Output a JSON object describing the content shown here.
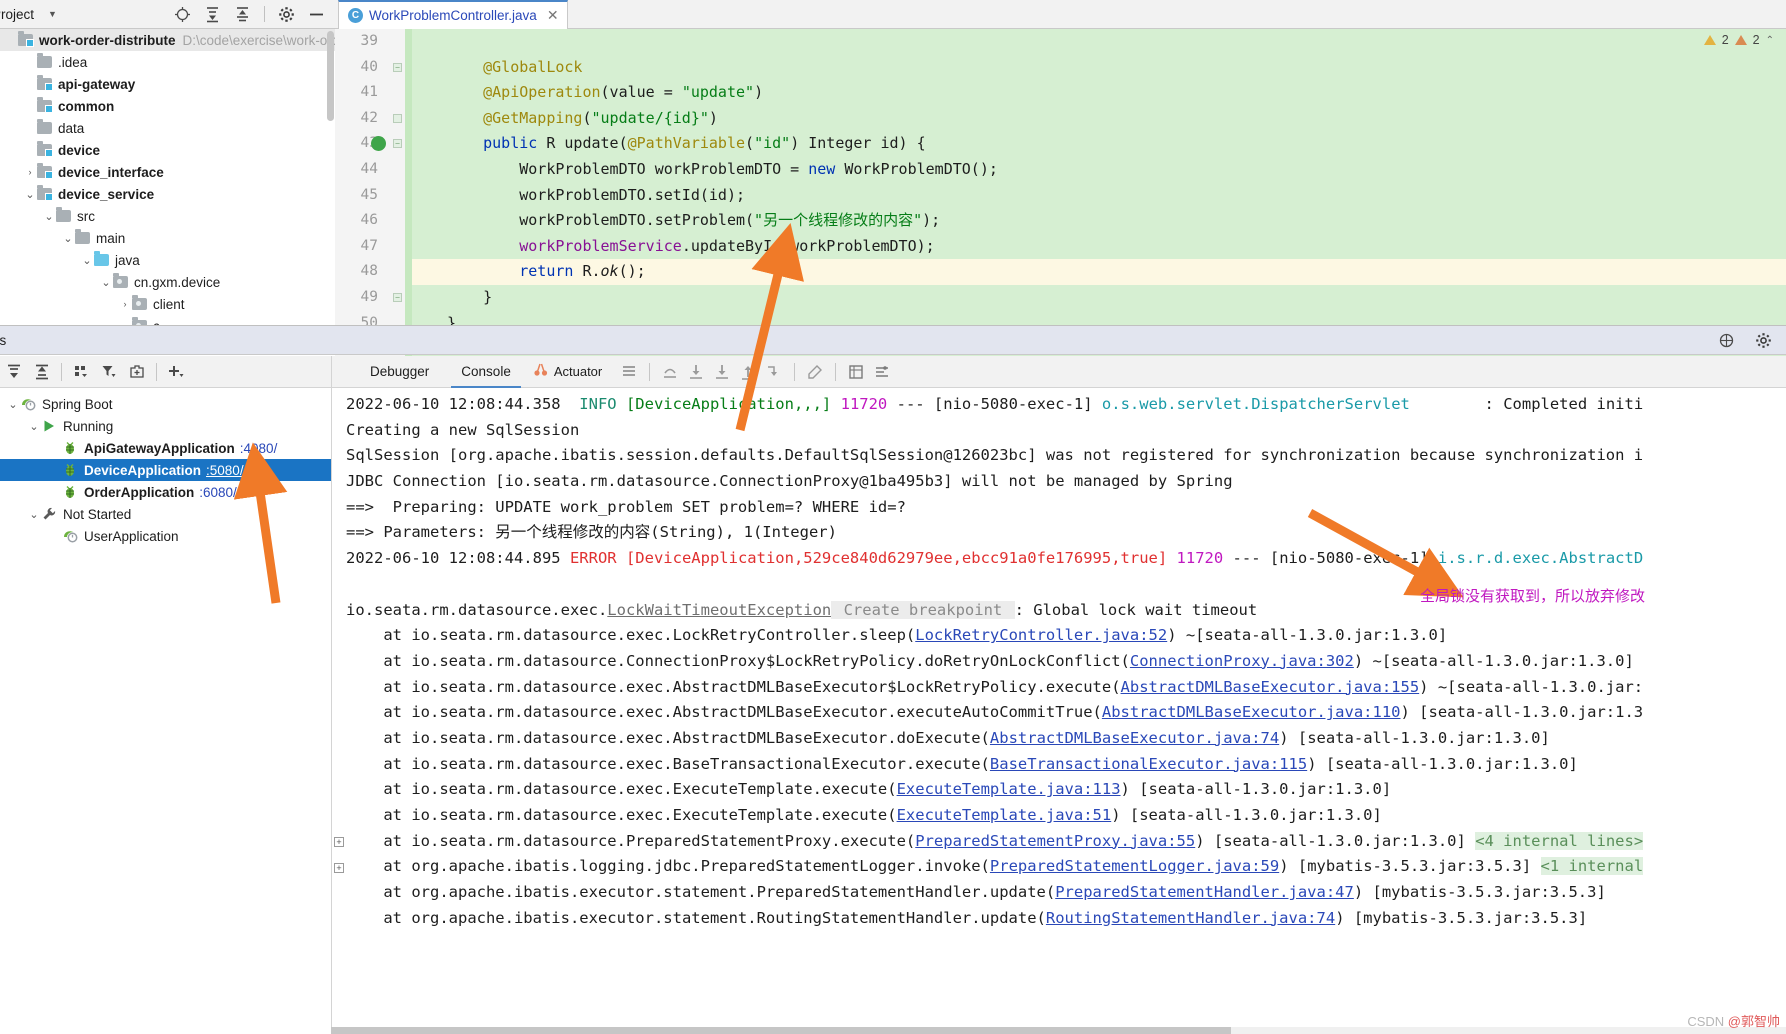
{
  "project_panel": {
    "title": "Project",
    "caret_icon": "chevron-down-icon",
    "toolbar_icons": [
      "locate-icon",
      "expand-all-icon",
      "collapse-all-icon",
      "settings-gear-icon",
      "hide-icon"
    ],
    "tree": [
      {
        "indent": 0,
        "arrow": "",
        "icon": "module-folder-icon",
        "label": "work-order-distribute",
        "bold": true,
        "path": "D:\\code\\exercise\\work-order-di"
      },
      {
        "indent": 1,
        "arrow": "",
        "icon": "folder-icon",
        "label": ".idea",
        "bold": false,
        "path": ""
      },
      {
        "indent": 1,
        "arrow": "",
        "icon": "module-folder-icon",
        "label": "api-gateway",
        "bold": true,
        "path": ""
      },
      {
        "indent": 1,
        "arrow": "",
        "icon": "module-folder-icon",
        "label": "common",
        "bold": true,
        "path": ""
      },
      {
        "indent": 1,
        "arrow": "",
        "icon": "folder-icon",
        "label": "data",
        "bold": false,
        "path": ""
      },
      {
        "indent": 1,
        "arrow": "",
        "icon": "module-folder-icon",
        "label": "device",
        "bold": true,
        "path": ""
      },
      {
        "indent": 1,
        "arrow": ">",
        "icon": "module-folder-icon",
        "label": "device_interface",
        "bold": true,
        "path": ""
      },
      {
        "indent": 1,
        "arrow": "v",
        "icon": "module-folder-icon",
        "label": "device_service",
        "bold": true,
        "path": ""
      },
      {
        "indent": 2,
        "arrow": "v",
        "icon": "folder-icon",
        "label": "src",
        "bold": false,
        "path": ""
      },
      {
        "indent": 3,
        "arrow": "v",
        "icon": "folder-icon",
        "label": "main",
        "bold": false,
        "path": ""
      },
      {
        "indent": 4,
        "arrow": "v",
        "icon": "source-folder-icon",
        "label": "java",
        "bold": false,
        "path": ""
      },
      {
        "indent": 5,
        "arrow": "v",
        "icon": "package-icon",
        "label": "cn.gxm.device",
        "bold": false,
        "path": ""
      },
      {
        "indent": 6,
        "arrow": ">",
        "icon": "package-icon",
        "label": "client",
        "bold": false,
        "path": ""
      },
      {
        "indent": 6,
        "arrow": "v",
        "icon": "package-icon",
        "label": "c",
        "bold": false,
        "path": ""
      }
    ]
  },
  "editor": {
    "tab": {
      "label": "WorkProblemController.java",
      "icon": "java-class-icon",
      "close_icon": "close-icon"
    },
    "warnings": {
      "yellow_count": "2",
      "orange_count": "2",
      "yellow_icon": "warning-triangle-icon",
      "orange_icon": "weak-warning-icon",
      "collapse_icon": "chevron-up-icon"
    },
    "first_line_number": 39,
    "lines": [
      {
        "n": 39,
        "text": "",
        "hl": false,
        "fold": ""
      },
      {
        "n": 40,
        "text": "    @GlobalLock",
        "hl": false,
        "fold": "-"
      },
      {
        "n": 41,
        "text": "    @ApiOperation(value = \"update\")",
        "hl": false,
        "fold": ""
      },
      {
        "n": 42,
        "text": "    @GetMapping(\"update/{id}\")",
        "hl": false,
        "fold": "^"
      },
      {
        "n": 43,
        "text": "    public R update(@PathVariable(\"id\") Integer id) {",
        "hl": false,
        "fold": "-"
      },
      {
        "n": 44,
        "text": "        WorkProblemDTO workProblemDTO = new WorkProblemDTO();",
        "hl": false,
        "fold": ""
      },
      {
        "n": 45,
        "text": "        workProblemDTO.setId(id);",
        "hl": false,
        "fold": ""
      },
      {
        "n": 46,
        "text": "        workProblemDTO.setProblem(\"另一个线程修改的内容\");",
        "hl": false,
        "fold": ""
      },
      {
        "n": 47,
        "text": "        workProblemService.updateById(workProblemDTO);",
        "hl": false,
        "fold": ""
      },
      {
        "n": 48,
        "text": "        return R.ok();",
        "hl": true,
        "fold": ""
      },
      {
        "n": 49,
        "text": "    }",
        "hl": false,
        "fold": "-"
      },
      {
        "n": 50,
        "text": "}",
        "hl": false,
        "fold": ""
      }
    ]
  },
  "run_window": {
    "header_title": "es",
    "header_icons": [
      "layout-icon",
      "settings-gear-icon"
    ],
    "toolbar_icons": [
      "expand-all-icon",
      "collapse-all-icon",
      "group-icon",
      "filter-icon",
      "new-tab-icon",
      "add-icon"
    ],
    "tree": [
      {
        "indent": 0,
        "arrow": "v",
        "icon": "spring-boot-icon",
        "label": "Spring Boot",
        "bold": false,
        "port": "",
        "selected": false,
        "underline": false
      },
      {
        "indent": 1,
        "arrow": "v",
        "icon": "run-green-icon",
        "label": "Running",
        "bold": false,
        "port": "",
        "selected": false,
        "underline": false
      },
      {
        "indent": 2,
        "arrow": "",
        "icon": "spring-bean-icon",
        "label": "ApiGatewayApplication",
        "bold": true,
        "port": ":4080/",
        "selected": false,
        "underline": false
      },
      {
        "indent": 2,
        "arrow": "",
        "icon": "spring-bean-icon",
        "label": "DeviceApplication",
        "bold": true,
        "port": ":5080/",
        "selected": true,
        "underline": true
      },
      {
        "indent": 2,
        "arrow": "",
        "icon": "spring-bean-icon",
        "label": "OrderApplication",
        "bold": true,
        "port": ":6080/",
        "selected": false,
        "underline": false
      },
      {
        "indent": 1,
        "arrow": "v",
        "icon": "wrench-icon",
        "label": "Not Started",
        "bold": false,
        "port": "",
        "selected": false,
        "underline": false
      },
      {
        "indent": 2,
        "arrow": "",
        "icon": "spring-boot-icon",
        "label": "UserApplication",
        "bold": false,
        "port": "",
        "selected": false,
        "underline": false
      }
    ]
  },
  "console": {
    "tabs": [
      {
        "label": "Debugger",
        "active": false,
        "icon": ""
      },
      {
        "label": "Console",
        "active": true,
        "icon": ""
      },
      {
        "label": "Actuator",
        "active": false,
        "icon": "actuator-icon"
      }
    ],
    "toolbar_icons": [
      "soft-wrap-icon",
      "step-out-icon",
      "step-into-icon",
      "force-step-into-icon",
      "step-up-icon",
      "run-to-cursor-icon",
      "evaluate-icon",
      "mute-breakpoints-icon",
      "settings-list-icon"
    ],
    "log": [
      {
        "type": "info",
        "parts": [
          {
            "t": "2022-06-10 12:08:44.358  ",
            "c": "c-plain"
          },
          {
            "t": "INFO ",
            "c": "c-info"
          },
          {
            "t": "[DeviceApplication,,,] ",
            "c": "c-green"
          },
          {
            "t": "11720 ",
            "c": "c-magenta"
          },
          {
            "t": "--- [nio-5080-exec-1] ",
            "c": "c-plain"
          },
          {
            "t": "o.s.web.servlet.DispatcherServlet",
            "c": "c-teal"
          },
          {
            "t": "        : Completed initi",
            "c": "c-plain"
          }
        ]
      },
      {
        "type": "plain",
        "parts": [
          {
            "t": "Creating a new SqlSession",
            "c": "c-plain"
          }
        ]
      },
      {
        "type": "plain",
        "parts": [
          {
            "t": "SqlSession [org.apache.ibatis.session.defaults.DefaultSqlSession@126023bc] was not registered for synchronization because synchronization i",
            "c": "c-plain"
          }
        ]
      },
      {
        "type": "plain",
        "parts": [
          {
            "t": "JDBC Connection [io.seata.rm.datasource.ConnectionProxy@1ba495b3] will not be managed by Spring",
            "c": "c-plain"
          }
        ]
      },
      {
        "type": "plain",
        "parts": [
          {
            "t": "==>  Preparing: UPDATE work_problem SET problem=? WHERE id=?",
            "c": "c-plain"
          }
        ]
      },
      {
        "type": "plain",
        "parts": [
          {
            "t": "==> Parameters: 另一个线程修改的内容(String), 1(Integer)",
            "c": "c-plain"
          }
        ]
      },
      {
        "type": "error",
        "parts": [
          {
            "t": "2022-06-10 12:08:44.895 ",
            "c": "c-plain"
          },
          {
            "t": "ERROR ",
            "c": "c-red"
          },
          {
            "t": "[DeviceApplication,529ce840d62979ee,ebcc91a0fe176995,true] ",
            "c": "c-red"
          },
          {
            "t": "11720 ",
            "c": "c-magenta"
          },
          {
            "t": "--- [nio-5080-exec-1] ",
            "c": "c-plain"
          },
          {
            "t": "i.s.r.d.exec.AbstractD",
            "c": "c-teal"
          }
        ]
      },
      {
        "type": "blank",
        "parts": []
      },
      {
        "type": "exception",
        "parts": [
          {
            "t": "io.seata.rm.datasource.exec.",
            "c": "c-plain"
          },
          {
            "t": "LockWaitTimeoutException",
            "c": "c-exlink"
          },
          {
            "t": " Create breakpoint ",
            "c": "c-bp"
          },
          {
            "t": ": Global lock wait timeout",
            "c": "c-plain"
          }
        ]
      },
      {
        "type": "stack",
        "parts": [
          {
            "t": "    at io.seata.rm.datasource.exec.LockRetryController.sleep(",
            "c": "c-plain"
          },
          {
            "t": "LockRetryController.java:52",
            "c": "c-link"
          },
          {
            "t": ") ~[seata-all-1.3.0.jar:1.3.0]",
            "c": "c-plain"
          }
        ]
      },
      {
        "type": "stack",
        "parts": [
          {
            "t": "    at io.seata.rm.datasource.ConnectionProxy$LockRetryPolicy.doRetryOnLockConflict(",
            "c": "c-plain"
          },
          {
            "t": "ConnectionProxy.java:302",
            "c": "c-link"
          },
          {
            "t": ") ~[seata-all-1.3.0.jar:1.3.0]",
            "c": "c-plain"
          }
        ]
      },
      {
        "type": "stack",
        "parts": [
          {
            "t": "    at io.seata.rm.datasource.exec.AbstractDMLBaseExecutor$LockRetryPolicy.execute(",
            "c": "c-plain"
          },
          {
            "t": "AbstractDMLBaseExecutor.java:155",
            "c": "c-link"
          },
          {
            "t": ") ~[seata-all-1.3.0.jar:",
            "c": "c-plain"
          }
        ]
      },
      {
        "type": "stack",
        "parts": [
          {
            "t": "    at io.seata.rm.datasource.exec.AbstractDMLBaseExecutor.executeAutoCommitTrue(",
            "c": "c-plain"
          },
          {
            "t": "AbstractDMLBaseExecutor.java:110",
            "c": "c-link"
          },
          {
            "t": ") [seata-all-1.3.0.jar:1.3",
            "c": "c-plain"
          }
        ]
      },
      {
        "type": "stack",
        "parts": [
          {
            "t": "    at io.seata.rm.datasource.exec.AbstractDMLBaseExecutor.doExecute(",
            "c": "c-plain"
          },
          {
            "t": "AbstractDMLBaseExecutor.java:74",
            "c": "c-link"
          },
          {
            "t": ") [seata-all-1.3.0.jar:1.3.0]",
            "c": "c-plain"
          }
        ]
      },
      {
        "type": "stack",
        "parts": [
          {
            "t": "    at io.seata.rm.datasource.exec.BaseTransactionalExecutor.execute(",
            "c": "c-plain"
          },
          {
            "t": "BaseTransactionalExecutor.java:115",
            "c": "c-link"
          },
          {
            "t": ") [seata-all-1.3.0.jar:1.3.0]",
            "c": "c-plain"
          }
        ]
      },
      {
        "type": "stack",
        "parts": [
          {
            "t": "    at io.seata.rm.datasource.exec.ExecuteTemplate.execute(",
            "c": "c-plain"
          },
          {
            "t": "ExecuteTemplate.java:113",
            "c": "c-link"
          },
          {
            "t": ") [seata-all-1.3.0.jar:1.3.0]",
            "c": "c-plain"
          }
        ]
      },
      {
        "type": "stack",
        "parts": [
          {
            "t": "    at io.seata.rm.datasource.exec.ExecuteTemplate.execute(",
            "c": "c-plain"
          },
          {
            "t": "ExecuteTemplate.java:51",
            "c": "c-link"
          },
          {
            "t": ") [seata-all-1.3.0.jar:1.3.0]",
            "c": "c-plain"
          }
        ]
      },
      {
        "type": "stack-fold",
        "expander": "+",
        "parts": [
          {
            "t": "    at io.seata.rm.datasource.PreparedStatementProxy.execute(",
            "c": "c-plain"
          },
          {
            "t": "PreparedStatementProxy.java:55",
            "c": "c-link"
          },
          {
            "t": ") [seata-all-1.3.0.jar:1.3.0] ",
            "c": "c-plain"
          },
          {
            "t": "<4 internal lines>",
            "c": "c-fold"
          }
        ]
      },
      {
        "type": "stack-fold",
        "expander": "+",
        "parts": [
          {
            "t": "    at org.apache.ibatis.logging.jdbc.PreparedStatementLogger.invoke(",
            "c": "c-plain"
          },
          {
            "t": "PreparedStatementLogger.java:59",
            "c": "c-link"
          },
          {
            "t": ") [mybatis-3.5.3.jar:3.5.3] ",
            "c": "c-plain"
          },
          {
            "t": "<1 internal",
            "c": "c-fold"
          }
        ]
      },
      {
        "type": "stack",
        "parts": [
          {
            "t": "    at org.apache.ibatis.executor.statement.PreparedStatementHandler.update(",
            "c": "c-plain"
          },
          {
            "t": "PreparedStatementHandler.java:47",
            "c": "c-link"
          },
          {
            "t": ") [mybatis-3.5.3.jar:3.5.3]",
            "c": "c-plain"
          }
        ]
      },
      {
        "type": "stack",
        "parts": [
          {
            "t": "    at org.apache.ibatis.executor.statement.RoutingStatementHandler.update(",
            "c": "c-plain"
          },
          {
            "t": "RoutingStatementHandler.java:74",
            "c": "c-link"
          },
          {
            "t": ") [mybatis-3.5.3.jar:3.5.3]",
            "c": "c-plain"
          }
        ]
      }
    ]
  },
  "annotations": {
    "note_text": "全局锁没有获取到，所以放弃修改",
    "arrow_color": "#f07a28",
    "arrows": [
      "arrow-to-code-line",
      "arrow-to-device-application",
      "arrow-to-error-note"
    ]
  },
  "watermark": {
    "prefix": "CSDN ",
    "suffix": "@郭智帅"
  }
}
